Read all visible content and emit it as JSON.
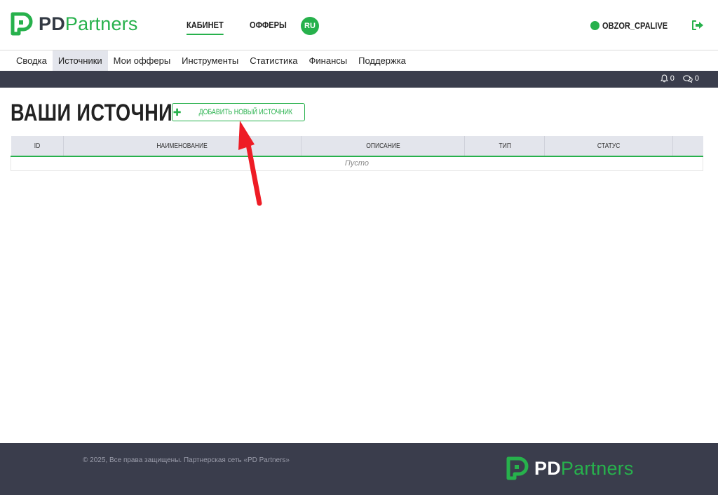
{
  "brand": {
    "pd": "PD",
    "partners": "Partners",
    "accent_color": "#27b14c"
  },
  "topnav": {
    "items": [
      {
        "label": "КАБИНЕТ"
      },
      {
        "label": "ОФФЕРЫ"
      }
    ]
  },
  "language": "RU",
  "user": {
    "name": "OBZOR_CPALIVE",
    "status_icon": "online-dot-icon",
    "logout_icon": "logout-icon"
  },
  "subnav": {
    "items": [
      {
        "label": "Сводка"
      },
      {
        "label": "Источники"
      },
      {
        "label": "Мои офферы"
      },
      {
        "label": "Инструменты"
      },
      {
        "label": "Статистика"
      },
      {
        "label": "Финансы"
      },
      {
        "label": "Поддержка"
      }
    ]
  },
  "counters": {
    "notifications": "0",
    "messages": "0"
  },
  "main": {
    "title": "ВАШИ ИСТОЧНИКИ",
    "add_button": {
      "icon": "plus-icon",
      "label": "ДОБАВИТЬ НОВЫЙ ИСТОЧНИК"
    },
    "table": {
      "columns": [
        "ID",
        "НАИМЕНОВАНИЕ",
        "ОПИСАНИЕ",
        "ТИП",
        "СТАТУС",
        ""
      ],
      "empty_text": "Пусто"
    }
  },
  "footer": {
    "copyright": "© 2025, Все права защищены. Партнерская сеть «PD Partners»"
  }
}
